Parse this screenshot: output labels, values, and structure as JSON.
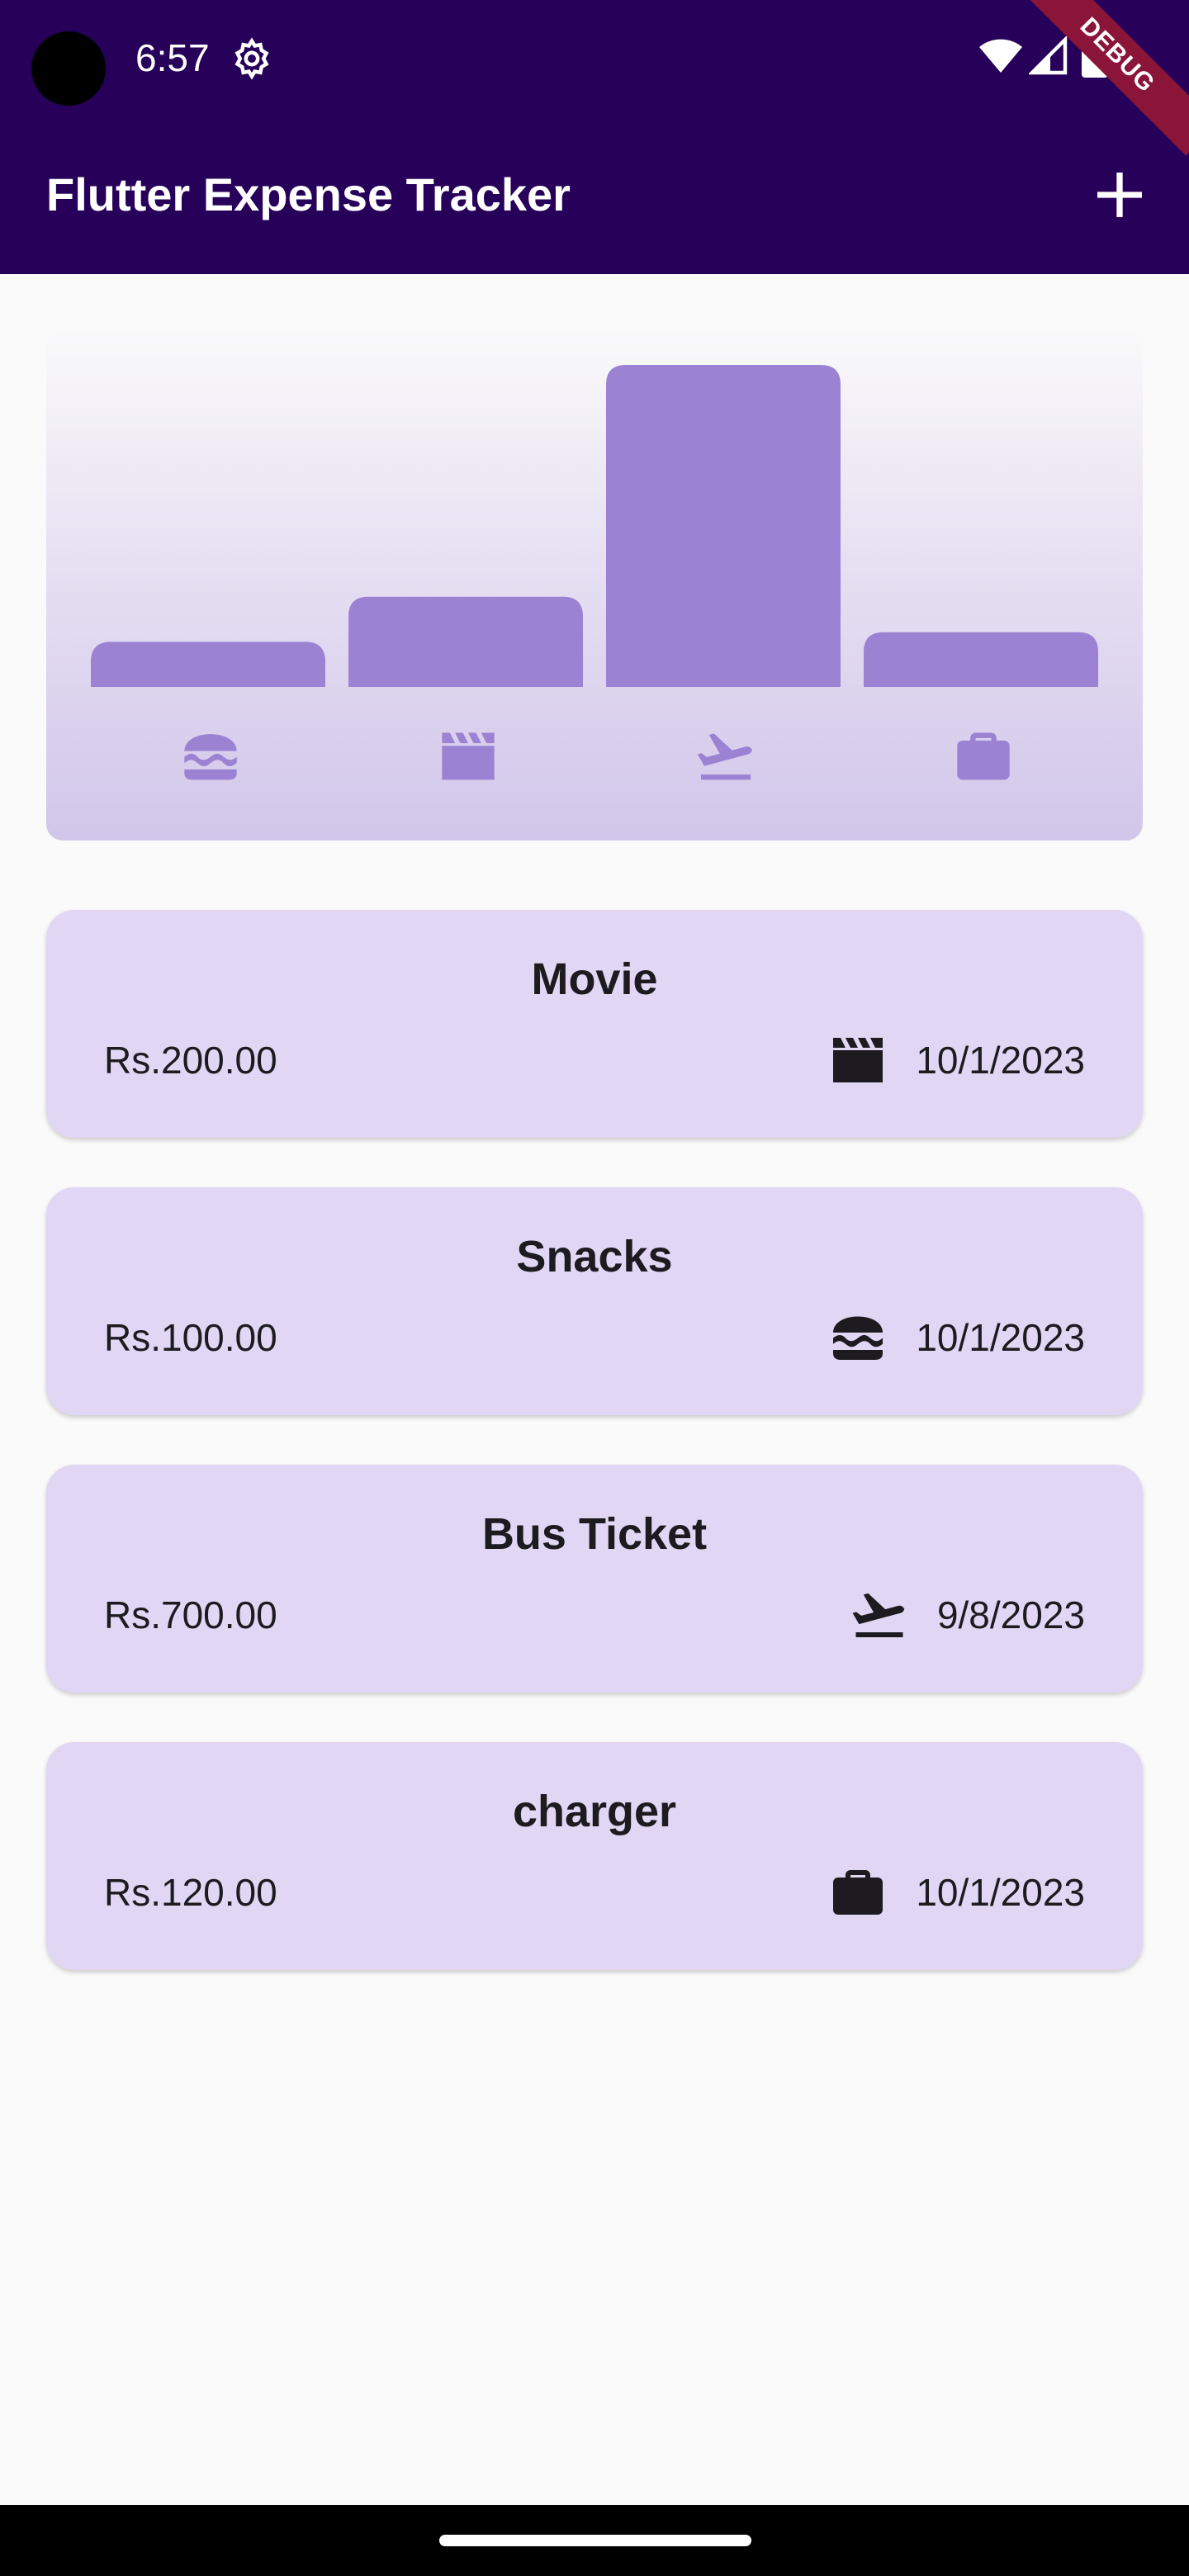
{
  "status_bar": {
    "time": "6:57",
    "icons": [
      "settings-icon",
      "wifi-icon",
      "signal-icon",
      "battery-icon"
    ]
  },
  "debug_banner": "DEBUG",
  "app_bar": {
    "title": "Flutter Expense Tracker",
    "action_icon": "add-icon",
    "background": "#27005a"
  },
  "chart": {
    "categories": [
      "food",
      "leisure",
      "travel",
      "work"
    ],
    "category_icons": [
      "burger-icon",
      "clapperboard-icon",
      "plane-departure-icon",
      "briefcase-icon"
    ],
    "bar_fill_fraction": [
      0.14,
      0.28,
      1.0,
      0.17
    ],
    "bar_color": "#9b82d3"
  },
  "expenses": [
    {
      "title": "Movie",
      "amount": "Rs.200.00",
      "category_icon": "clapperboard-icon",
      "date": "10/1/2023"
    },
    {
      "title": "Snacks",
      "amount": "Rs.100.00",
      "category_icon": "burger-icon",
      "date": "10/1/2023"
    },
    {
      "title": "Bus Ticket",
      "amount": "Rs.700.00",
      "category_icon": "plane-departure-icon",
      "date": "9/8/2023"
    },
    {
      "title": "charger",
      "amount": "Rs.120.00",
      "category_icon": "briefcase-icon",
      "date": "10/1/2023"
    }
  ],
  "colors": {
    "card_background": "#e1d6f4",
    "text_primary": "#1d1b20",
    "page_background": "#fafafa"
  }
}
